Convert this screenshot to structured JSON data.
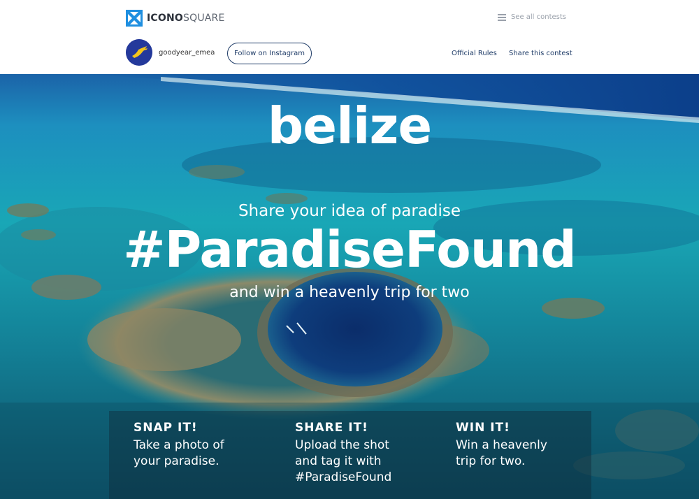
{
  "header": {
    "logo_bold": "ICONO",
    "logo_light": "SQUARE",
    "see_all": "See all contests"
  },
  "account": {
    "username": "goodyear_emea",
    "follow_label": "Follow on Instagram",
    "official_rules": "Official Rules",
    "share_contest": "Share this contest"
  },
  "hero": {
    "brand": "belize",
    "tagline": "Share your idea of paradise",
    "hashtag": "#ParadiseFound",
    "prize": "and win a heavenly trip for two"
  },
  "steps": [
    {
      "title": "SNAP IT!",
      "lines": [
        "Take a photo of",
        "your paradise."
      ]
    },
    {
      "title": "SHARE IT!",
      "lines": [
        "Upload the shot",
        "and tag it with",
        "#ParadiseFound"
      ]
    },
    {
      "title": "WIN IT!",
      "lines": [
        "Win a heavenly",
        "trip for two."
      ]
    }
  ],
  "colors": {
    "navy": "#1e3b67",
    "ocean_deep": "#0b2f6e",
    "ocean_turquoise": "#1aa3b8",
    "logo_blue": "#1f8fe0"
  },
  "icons": {
    "logo": "iconosquare-logo",
    "menu": "hamburger-icon",
    "avatar": "goodyear-wingfoot"
  }
}
